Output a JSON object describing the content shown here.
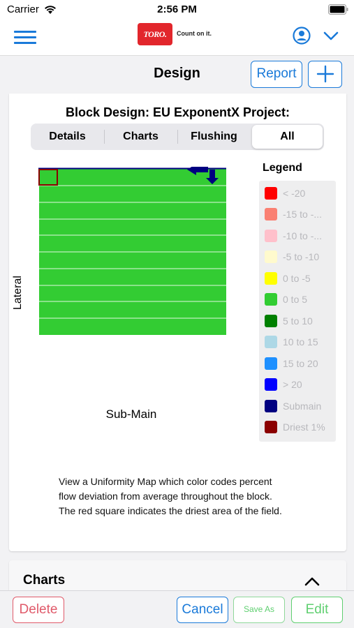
{
  "status": {
    "carrier": "Carrier",
    "time": "2:56 PM"
  },
  "nav": {
    "logo_text": "TORO.",
    "logo_tagline": "Count on it."
  },
  "title": {
    "text": "Design",
    "report_label": "Report",
    "add_label": "+"
  },
  "card": {
    "title": "Block Design: EU ExponentX Project:",
    "tabs": [
      {
        "label": "Details",
        "active": false
      },
      {
        "label": "Charts",
        "active": false
      },
      {
        "label": "Flushing",
        "active": false
      },
      {
        "label": "All",
        "active": true
      }
    ],
    "map": {
      "lateral_label": "Lateral",
      "submain_label": "Sub-Main",
      "fill_color": "#33cc33",
      "line_color": "#000080",
      "driest_color": "#8b0000"
    },
    "legend": {
      "title": "Legend",
      "items": [
        {
          "label": "< -20",
          "color": "#ff0000"
        },
        {
          "label": "-15 to -...",
          "color": "#fa8072"
        },
        {
          "label": "-10 to -...",
          "color": "#ffc0cb"
        },
        {
          "label": "-5 to -10",
          "color": "#fffacd"
        },
        {
          "label": "0 to -5",
          "color": "#ffff00"
        },
        {
          "label": "0 to 5",
          "color": "#32cd32"
        },
        {
          "label": "5 to 10",
          "color": "#008000"
        },
        {
          "label": "10 to 15",
          "color": "#add8e6"
        },
        {
          "label": "15 to 20",
          "color": "#1e90ff"
        },
        {
          "label": "> 20",
          "color": "#0000ff"
        },
        {
          "label": "Submain",
          "color": "#000080"
        },
        {
          "label": "Driest 1%",
          "color": "#8b0000"
        }
      ]
    },
    "description": "View a Uniformity Map which color codes percent flow deviation from average throughout the block. The red square indicates the driest area of the field."
  },
  "charts_section": {
    "title": "Charts"
  },
  "toolbar": {
    "delete_label": "Delete",
    "cancel_label": "Cancel",
    "save_as_label": "Save As",
    "edit_label": "Edit"
  }
}
